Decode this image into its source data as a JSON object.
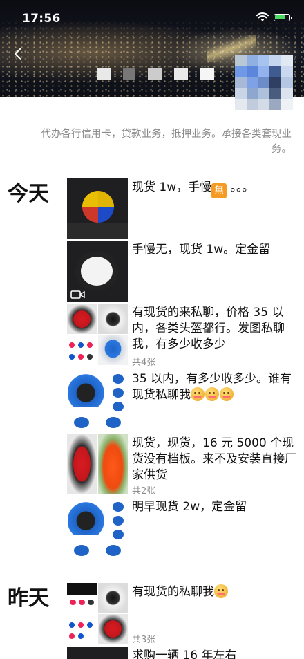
{
  "status_bar": {
    "time": "17:56"
  },
  "profile": {
    "signature": "代办各行信用卡，贷款业务，抵押业务。承接各类套现业务。"
  },
  "days": [
    {
      "label": "今天",
      "posts": [
        {
          "text_before": "现货 1w，手慢",
          "badge": "無",
          "text_after": " 。。。",
          "images": 1
        },
        {
          "text": "手慢无，现货 1w。定金留",
          "images": 1,
          "is_video": true
        },
        {
          "text": "有现货的来私聊，价格 35 以内，各类头盔都行。发图私聊我，有多少收多少",
          "images": 4,
          "count": "共4张"
        },
        {
          "text": "35 以内，有多少收多少。谁有现货私聊我",
          "emoji_count": 3,
          "images": 1
        },
        {
          "text": "现货，现货，16 元 5000 个现货没有档板。来不及安装直接厂家供货",
          "images": 2,
          "count": "共2张"
        },
        {
          "text": "明早现货 2w，定金留",
          "images": 1
        }
      ]
    },
    {
      "label": "昨天",
      "posts": [
        {
          "text": "有现货的私聊我",
          "emoji_count": 1,
          "images": 3,
          "count": "共3张"
        },
        {
          "text": "求购一辆 16 年左右",
          "images": 1
        }
      ]
    }
  ],
  "icons": [
    "wifi-icon",
    "battery-icon",
    "back-icon",
    "video-icon",
    "emoji-icon"
  ],
  "colors": {
    "signature_text": "#8a8a8a",
    "count_text": "#8c8c8c",
    "battery": "#4cd964",
    "badge": "#f59a23"
  }
}
